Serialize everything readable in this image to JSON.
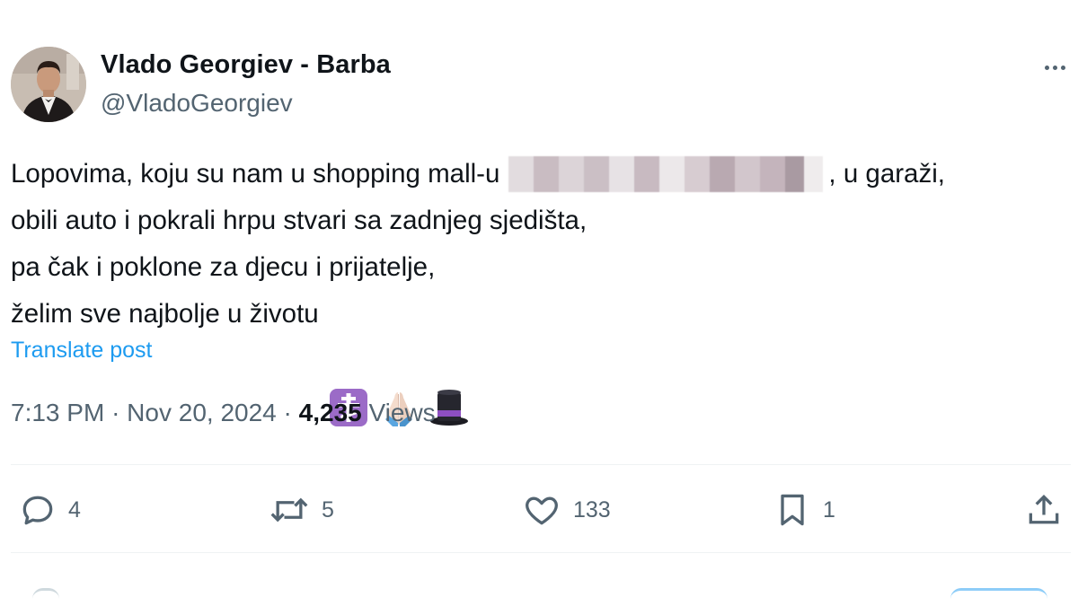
{
  "author": {
    "display_name": "Vlado Georgiev - Barba",
    "handle": "@VladoGeorgiev"
  },
  "post": {
    "lines": [
      [
        "Lopovima, koju su nam u shopping mall-u",
        ", u garaži,"
      ],
      [
        "obili auto i pokrali hrpu stvari sa zadnjeg sjedišta,"
      ],
      [
        "pa čak i poklone za djecu i prijatelje,"
      ],
      [
        "želim sve najbolje u životu"
      ]
    ],
    "emojis": [
      "orthodox-cross-icon",
      "folded-hands-icon",
      "top-hat-icon"
    ],
    "translate_label": "Translate post"
  },
  "meta": {
    "time": "7:13 PM",
    "date": "Nov 20, 2024",
    "separator": "·",
    "views_count": "4,235",
    "views_label": "Views"
  },
  "actions": {
    "replies": "4",
    "reposts": "5",
    "likes": "133",
    "bookmarks": "1"
  },
  "colors": {
    "text": "#0f1419",
    "secondary": "#536471",
    "link": "#1d9bf0",
    "divider": "#eff3f4"
  }
}
